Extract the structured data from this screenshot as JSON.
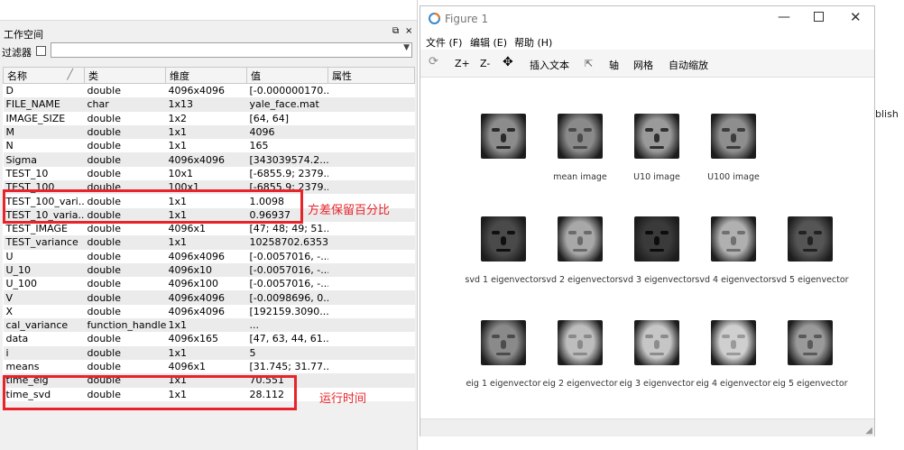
{
  "workspace": {
    "title": "工作空间",
    "undock_icon": "⧉",
    "close_icon": "×",
    "filter_label": "过滤器",
    "filter_value": "",
    "columns": [
      "名称",
      "类",
      "维度",
      "值",
      "属性"
    ],
    "rows": [
      [
        "D",
        "double",
        "4096x4096",
        "[-0.000000170..."
      ],
      [
        "FILE_NAME",
        "char",
        "1x13",
        "yale_face.mat"
      ],
      [
        "IMAGE_SIZE",
        "double",
        "1x2",
        "[64, 64]"
      ],
      [
        "M",
        "double",
        "1x1",
        "4096"
      ],
      [
        "N",
        "double",
        "1x1",
        "165"
      ],
      [
        "Sigma",
        "double",
        "4096x4096",
        "[343039574.2..."
      ],
      [
        "TEST_10",
        "double",
        "10x1",
        "[-6855.9; 2379..."
      ],
      [
        "TEST_100",
        "double",
        "100x1",
        "[-6855.9; 2379..."
      ],
      [
        "TEST_100_vari...",
        "double",
        "1x1",
        "1.0098"
      ],
      [
        "TEST_10_varia...",
        "double",
        "1x1",
        "0.96937"
      ],
      [
        "TEST_IMAGE",
        "double",
        "4096x1",
        "[47; 48; 49; 51..."
      ],
      [
        "TEST_variance",
        "double",
        "1x1",
        "10258702.63530"
      ],
      [
        "U",
        "double",
        "4096x4096",
        "[-0.0057016, -..."
      ],
      [
        "U_10",
        "double",
        "4096x10",
        "[-0.0057016, -..."
      ],
      [
        "U_100",
        "double",
        "4096x100",
        "[-0.0057016, -..."
      ],
      [
        "V",
        "double",
        "4096x4096",
        "[-0.0098696, 0..."
      ],
      [
        "X",
        "double",
        "4096x4096",
        "[192159.3090..."
      ],
      [
        "cal_variance",
        "function_handle",
        "1x1",
        "..."
      ],
      [
        "data",
        "double",
        "4096x165",
        "[47, 63, 44, 61..."
      ],
      [
        "i",
        "double",
        "1x1",
        "5"
      ],
      [
        "means",
        "double",
        "4096x1",
        "[31.745; 31.77..."
      ],
      [
        "time_eig",
        "double",
        "1x1",
        "70.551"
      ],
      [
        "time_svd",
        "double",
        "1x1",
        "28.112"
      ]
    ]
  },
  "annotations": {
    "variance_note": "方差保留百分比",
    "time_note": "运行时间"
  },
  "figure": {
    "title": "Figure 1",
    "minimize_icon": "—",
    "close_icon": "✕",
    "menu": [
      "文件 (F)",
      "编辑 (E)",
      "帮助 (H)"
    ],
    "toolbar": {
      "rotate_icon": "⟳",
      "zoom_in": "Z+",
      "zoom_out": "Z-",
      "pan_icon": "✥",
      "insert_text": "插入文本",
      "cursor_icon": "⇱",
      "axis": "轴",
      "grid": "网格",
      "autoscale": "自动缩放"
    },
    "captions": [
      "",
      "mean image",
      "U10 image",
      "U100 image",
      "svd 1 eigenvector",
      "svd 2 eigenvector",
      "svd 3 eigenvector",
      "svd 4 eigenvector",
      "svd 5 eigenvector",
      "eig 1 eigenvector",
      "eig 2 eigenvector",
      "eig 3 eigenvector",
      "eig 4 eigenvector",
      "eig 5 eigenvector"
    ],
    "resize_icon": "◢"
  },
  "background": {
    "partial_text": "blish"
  },
  "colors": {
    "annotation": "#e8232a"
  }
}
